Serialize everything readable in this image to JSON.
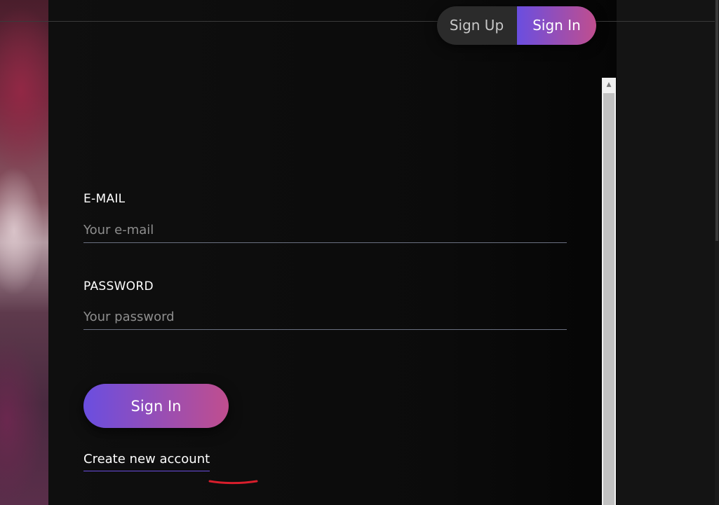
{
  "toggle": {
    "signup_label": "Sign Up",
    "signin_label": "Sign In"
  },
  "form": {
    "email": {
      "label": "E-MAIL",
      "placeholder": "Your e-mail",
      "value": ""
    },
    "password": {
      "label": "PASSWORD",
      "placeholder": "Your password",
      "value": ""
    },
    "submit_label": "Sign In",
    "create_account_label": "Create new account"
  },
  "colors": {
    "accent_start": "#6a4ee0",
    "accent_end": "#c04e8e",
    "annotation": "#d81e2c"
  },
  "icons": {
    "scroll_up": "triangle-up"
  }
}
